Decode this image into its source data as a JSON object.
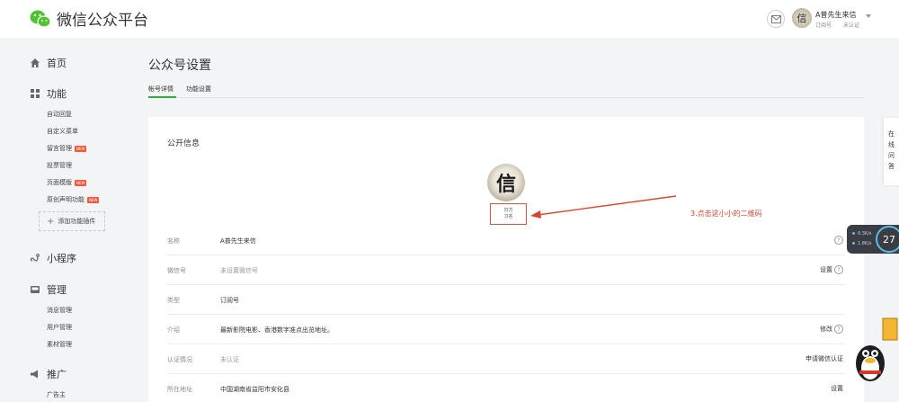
{
  "header": {
    "brand_title": "微信公众平台",
    "account_name": "A普先生来信",
    "account_type": "订阅号",
    "account_status": "未认证",
    "avatar_glyph": "信"
  },
  "sidebar": {
    "home": "首页",
    "features": "功能",
    "feature_items": [
      {
        "label": "自动回复",
        "new": false
      },
      {
        "label": "自定义菜单",
        "new": false
      },
      {
        "label": "留言管理",
        "new": true
      },
      {
        "label": "投票管理",
        "new": false
      },
      {
        "label": "页面模版",
        "new": true
      },
      {
        "label": "原创声明功能",
        "new": true
      }
    ],
    "new_badge": "NEW",
    "add_plugin": "添加功能插件",
    "mini_program": "小程序",
    "manage": "管理",
    "manage_items": [
      "消息管理",
      "用户管理",
      "素材管理"
    ],
    "promote": "推广",
    "promote_items": [
      "广告主"
    ]
  },
  "main": {
    "page_title": "公众号设置",
    "tabs": [
      {
        "label": "帐号详情",
        "active": true
      },
      {
        "label": "功能设置",
        "active": false
      }
    ],
    "section_title": "公开信息",
    "avatar_glyph": "信",
    "qr_lines": [
      "日方",
      "习名"
    ],
    "annotation": "3.点击这小小的二维码",
    "rows": [
      {
        "label": "名称",
        "value": "A普先生来信",
        "muted": false,
        "action": "",
        "help": true
      },
      {
        "label": "微信号",
        "value": "未设置微信号",
        "muted": true,
        "action": "设置",
        "help": true
      },
      {
        "label": "类型",
        "value": "订阅号",
        "muted": false,
        "action": "",
        "help": false
      },
      {
        "label": "介绍",
        "value": "最新影院电影、香港数字准点出览地址。",
        "muted": false,
        "action": "修改",
        "help": true
      },
      {
        "label": "认证情况",
        "value": "未认证",
        "muted": true,
        "action": "申请微信认证",
        "help": false
      },
      {
        "label": "所在地址",
        "value": "中国湖南省益阳市安化县",
        "muted": false,
        "action": "设置",
        "help": false
      }
    ]
  },
  "floating": {
    "side_chars": [
      "在",
      "线",
      "问",
      "答"
    ],
    "speed_up": "0.3K/s",
    "speed_down": "1.8K/s",
    "speed_percent": "27"
  },
  "colors": {
    "accent_green": "#2bb13a",
    "annotation_red": "#d8462f",
    "badge_red": "#f05a3a"
  }
}
